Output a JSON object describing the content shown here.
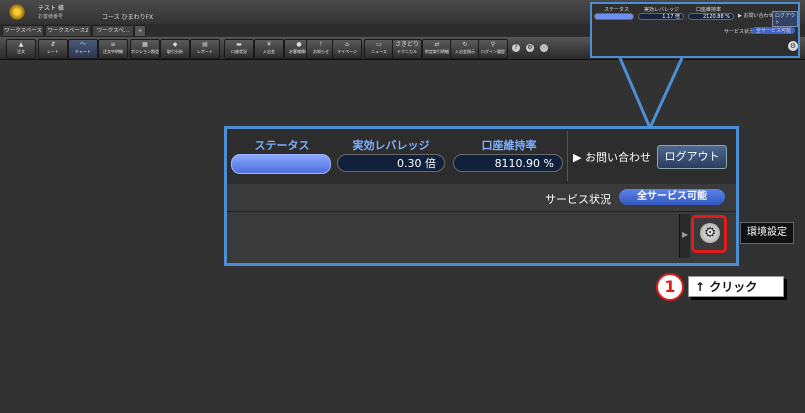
{
  "header": {
    "account_name": "テスト 様",
    "account_number": "お客様番号",
    "course": "コース  ひまわりFX"
  },
  "tabs": [
    "ワークスペース",
    "ワークスペース2",
    "ワークスペ…"
  ],
  "toolbar": [
    {
      "label": "注文",
      "icon": "▲"
    },
    {
      "label": "レート",
      "icon": "⇵"
    },
    {
      "label": "チャート",
      "icon": "〜"
    },
    {
      "label": "注文中明細",
      "icon": "≡"
    },
    {
      "label": "ポジション照会",
      "icon": "▦"
    },
    {
      "label": "取引分析",
      "icon": "◆"
    },
    {
      "label": "レポート",
      "icon": "▤"
    },
    {
      "label": "口座状況",
      "icon": "▬"
    },
    {
      "label": "入出金",
      "icon": "¥"
    },
    {
      "label": "お客様情報",
      "icon": "●"
    },
    {
      "label": "お知らせ",
      "icon": "!"
    },
    {
      "label": "マイページ",
      "icon": "⌂"
    },
    {
      "label": "ニュース",
      "icon": "▭"
    },
    {
      "label": "テクニカル",
      "icon": "さきどり"
    },
    {
      "label": "約定取引明細",
      "icon": "⇄"
    },
    {
      "label": "入出金指示",
      "icon": "↻"
    },
    {
      "label": "ログイン履歴",
      "icon": "⚲"
    }
  ],
  "mini_panel": {
    "status_label": "ステータス",
    "leverage_label": "実効レバレッジ",
    "ratio_label": "口座維持率",
    "leverage_value": "1.17 倍",
    "ratio_value": "2120.88 %",
    "contact": "お問い合わせ",
    "logout": "ログアウト",
    "service_label": "サービス状況",
    "service_value": "全サービス可能"
  },
  "zoom_panel": {
    "status_label": "ステータス",
    "leverage_label": "実効レバレッジ",
    "ratio_label": "口座維持率",
    "leverage_value": "0.30 倍",
    "ratio_value": "8110.90 %",
    "contact": "▶ お問い合わせ",
    "logout": "ログアウト",
    "service_label": "サービス状況",
    "service_value": "全サービス可能"
  },
  "tooltip": "環境設定",
  "step": {
    "number": "1",
    "instruction": "↑ クリック"
  },
  "colors": {
    "highlight_blue": "#4d8fd6",
    "highlight_red": "#e01b1b",
    "label_blue": "#7db0ff"
  }
}
